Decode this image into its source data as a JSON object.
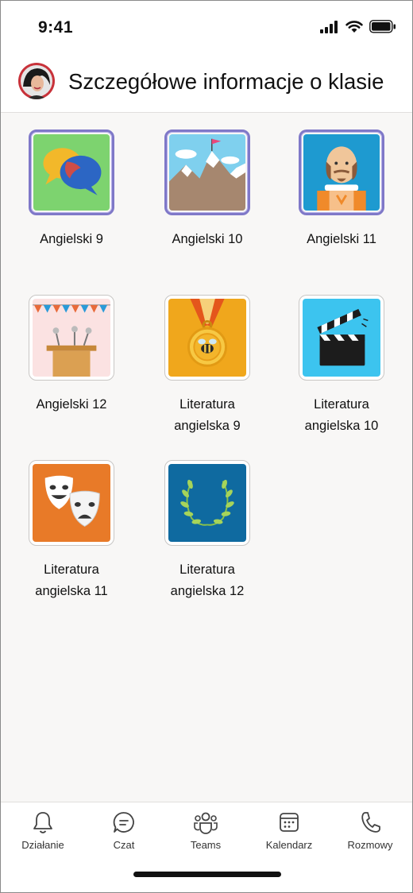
{
  "status_bar": {
    "time": "9:41"
  },
  "header": {
    "title": "Szczegółowe informacje o klasie"
  },
  "classes": [
    {
      "line1": "Angielski 9",
      "line2": "",
      "icon": "speech-bubbles-icon"
    },
    {
      "line1": "Angielski 10",
      "line2": "",
      "icon": "mountain-flag-icon"
    },
    {
      "line1": "Angielski 11",
      "line2": "",
      "icon": "shakespeare-icon"
    },
    {
      "line1": "Angielski 12",
      "line2": "",
      "icon": "podium-icon"
    },
    {
      "line1": "Literatura",
      "line2": "angielska 9",
      "icon": "medal-bee-icon"
    },
    {
      "line1": "Literatura",
      "line2": "angielska 10",
      "icon": "clapperboard-icon"
    },
    {
      "line1": "Literatura",
      "line2": "angielska 11",
      "icon": "theater-masks-icon"
    },
    {
      "line1": "Literatura",
      "line2": "angielska 12",
      "icon": "laurel-wreath-icon"
    }
  ],
  "nav": [
    {
      "label": "Działanie",
      "icon": "bell-icon"
    },
    {
      "label": "Czat",
      "icon": "chat-icon"
    },
    {
      "label": "Teams",
      "icon": "teams-icon"
    },
    {
      "label": "Kalendarz",
      "icon": "calendar-icon"
    },
    {
      "label": "Rozmowy",
      "icon": "phone-icon"
    }
  ],
  "colors": {
    "accent": "#7f78c8",
    "background": "#f8f7f6"
  }
}
